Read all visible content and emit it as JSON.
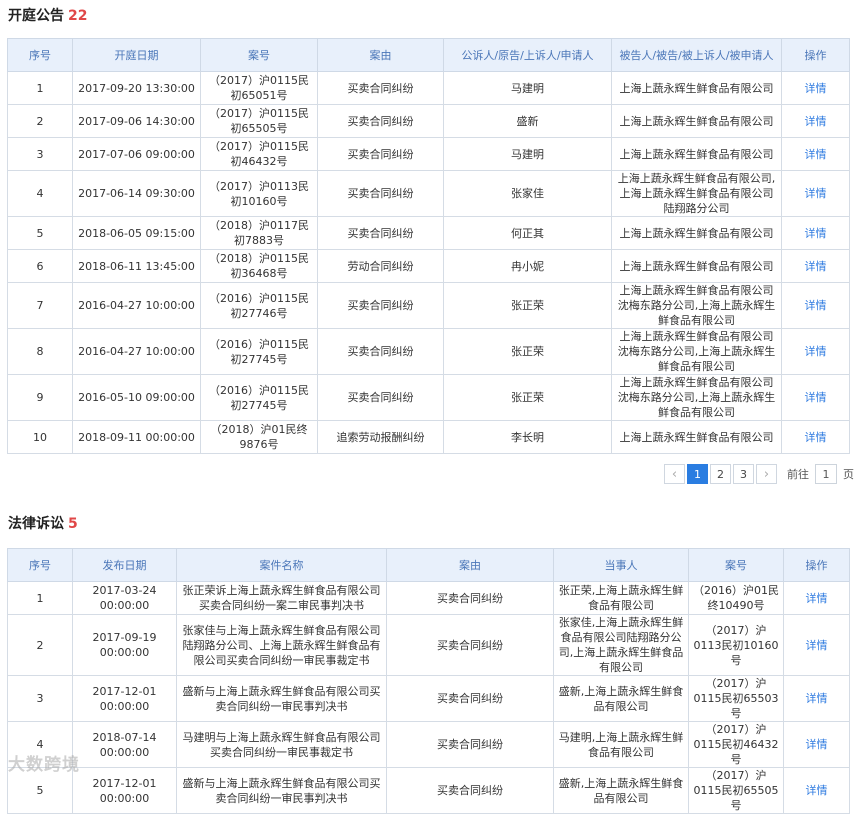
{
  "hearing": {
    "title": "开庭公告",
    "count": "22",
    "headers": [
      "序号",
      "开庭日期",
      "案号",
      "案由",
      "公诉人/原告/上诉人/申请人",
      "被告人/被告/被上诉人/被申请人",
      "操作"
    ],
    "rows": [
      [
        "1",
        "2017-09-20 13:30:00",
        "（2017）沪0115民初65051号",
        "买卖合同纠纷",
        "马建明",
        "上海上蔬永辉生鲜食品有限公司",
        "详情"
      ],
      [
        "2",
        "2017-09-06 14:30:00",
        "（2017）沪0115民初65505号",
        "买卖合同纠纷",
        "盛新",
        "上海上蔬永辉生鲜食品有限公司",
        "详情"
      ],
      [
        "3",
        "2017-07-06 09:00:00",
        "（2017）沪0115民初46432号",
        "买卖合同纠纷",
        "马建明",
        "上海上蔬永辉生鲜食品有限公司",
        "详情"
      ],
      [
        "4",
        "2017-06-14 09:30:00",
        "（2017）沪0113民初10160号",
        "买卖合同纠纷",
        "张家佳",
        "上海上蔬永辉生鲜食品有限公司,上海上蔬永辉生鲜食品有限公司陆翔路分公司",
        "详情"
      ],
      [
        "5",
        "2018-06-05 09:15:00",
        "（2018）沪0117民初7883号",
        "买卖合同纠纷",
        "何正其",
        "上海上蔬永辉生鲜食品有限公司",
        "详情"
      ],
      [
        "6",
        "2018-06-11 13:45:00",
        "（2018）沪0115民初36468号",
        "劳动合同纠纷",
        "冉小妮",
        "上海上蔬永辉生鲜食品有限公司",
        "详情"
      ],
      [
        "7",
        "2016-04-27 10:00:00",
        "（2016）沪0115民初27746号",
        "买卖合同纠纷",
        "张正荣",
        "上海上蔬永辉生鲜食品有限公司沈梅东路分公司,上海上蔬永辉生鲜食品有限公司",
        "详情"
      ],
      [
        "8",
        "2016-04-27 10:00:00",
        "（2016）沪0115民初27745号",
        "买卖合同纠纷",
        "张正荣",
        "上海上蔬永辉生鲜食品有限公司沈梅东路分公司,上海上蔬永辉生鲜食品有限公司",
        "详情"
      ],
      [
        "9",
        "2016-05-10 09:00:00",
        "（2016）沪0115民初27745号",
        "买卖合同纠纷",
        "张正荣",
        "上海上蔬永辉生鲜食品有限公司沈梅东路分公司,上海上蔬永辉生鲜食品有限公司",
        "详情"
      ],
      [
        "10",
        "2018-09-11 00:00:00",
        "（2018）沪01民终9876号",
        "追索劳动报酬纠纷",
        "李长明",
        "上海上蔬永辉生鲜食品有限公司",
        "详情"
      ]
    ]
  },
  "pagination": {
    "prev_icon": "‹",
    "pages": [
      "1",
      "2",
      "3"
    ],
    "next_icon": "›",
    "goto_label": "前往",
    "goto_value": "1",
    "page_unit": "页"
  },
  "lawsuit": {
    "title": "法律诉讼",
    "count": "5",
    "headers": [
      "序号",
      "发布日期",
      "案件名称",
      "案由",
      "当事人",
      "案号",
      "操作"
    ],
    "rows": [
      [
        "1",
        "2017-03-24 00:00:00",
        "张正荣诉上海上蔬永辉生鲜食品有限公司买卖合同纠纷一案二审民事判决书",
        "买卖合同纠纷",
        "张正荣,上海上蔬永辉生鲜食品有限公司",
        "（2016）沪01民终10490号",
        "详情"
      ],
      [
        "2",
        "2017-09-19 00:00:00",
        "张家佳与上海上蔬永辉生鲜食品有限公司陆翔路分公司、上海上蔬永辉生鲜食品有限公司买卖合同纠纷一审民事裁定书",
        "买卖合同纠纷",
        "张家佳,上海上蔬永辉生鲜食品有限公司陆翔路分公司,上海上蔬永辉生鲜食品有限公司",
        "（2017）沪0113民初10160号",
        "详情"
      ],
      [
        "3",
        "2017-12-01 00:00:00",
        "盛新与上海上蔬永辉生鲜食品有限公司买卖合同纠纷一审民事判决书",
        "买卖合同纠纷",
        "盛新,上海上蔬永辉生鲜食品有限公司",
        "（2017）沪0115民初65503号",
        "详情"
      ],
      [
        "4",
        "2018-07-14 00:00:00",
        "马建明与上海上蔬永辉生鲜食品有限公司买卖合同纠纷一审民事裁定书",
        "买卖合同纠纷",
        "马建明,上海上蔬永辉生鲜食品有限公司",
        "（2017）沪0115民初46432号",
        "详情"
      ],
      [
        "5",
        "2017-12-01 00:00:00",
        "盛新与上海上蔬永辉生鲜食品有限公司买卖合同纠纷一审民事判决书",
        "买卖合同纠纷",
        "盛新,上海上蔬永辉生鲜食品有限公司",
        "（2017）沪0115民初65505号",
        "详情"
      ]
    ]
  },
  "watermark": "大数跨境"
}
